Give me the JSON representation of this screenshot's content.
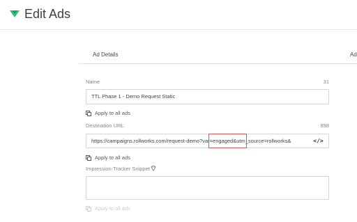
{
  "header": {
    "title": "Edit Ads",
    "logo_color": "#2ec27e"
  },
  "tabs": [
    {
      "label": "Ad Details"
    },
    {
      "label": "Ad"
    }
  ],
  "form": {
    "name": {
      "label": "Name",
      "counter": "31",
      "value": "TTL Phase 1 - Demo Request Static"
    },
    "name_apply": {
      "label": "Apply to all ads",
      "icon": "copy-icon"
    },
    "destination_url": {
      "label": "Destination URL",
      "counter": "898",
      "value": "https://campaigns.rollworks.com/request-demo?var=engaged&utm_source=rollworks&",
      "code_button_label": "</>"
    },
    "url_apply": {
      "label": "Apply to all ads",
      "icon": "copy-icon"
    },
    "impression_tracker": {
      "label": "Impression-Tracker Snippet",
      "icon": "diamond-icon",
      "value": ""
    },
    "tracker_apply": {
      "label": "Apply to all ads",
      "icon": "copy-icon",
      "disabled": true
    }
  },
  "colors": {
    "accent": "#2ec27e",
    "highlight_border": "#e05252"
  }
}
